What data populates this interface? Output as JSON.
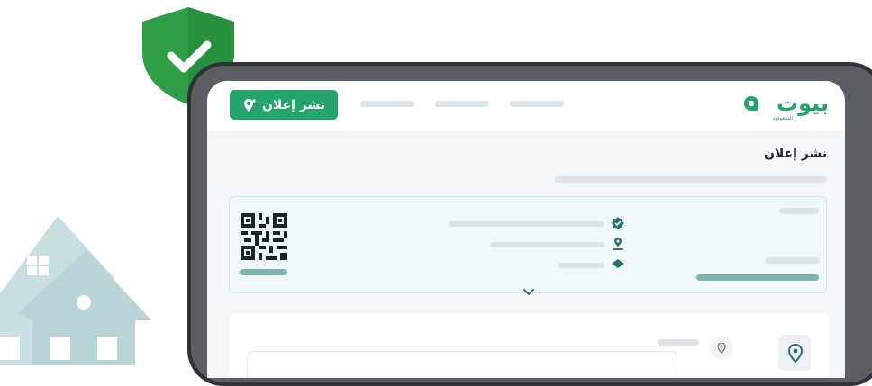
{
  "header": {
    "post_ad_label": "نشر إعلان",
    "logo_text": "بيوت",
    "logo_sub": "السعودية"
  },
  "main": {
    "page_title": "نشر إعلان"
  },
  "colors": {
    "brand_green": "#23a46a",
    "teal_bar": "#7fb4b3",
    "shield_green": "#2e9e47"
  },
  "icons": {
    "post_button": "location-pin-plus-icon",
    "shield": "shield-check-icon",
    "info_rows": [
      "badge-check-icon",
      "location-pin-icon",
      "layers-icon"
    ],
    "expand": "chevron-down-icon",
    "location": "map-pin-icon"
  }
}
